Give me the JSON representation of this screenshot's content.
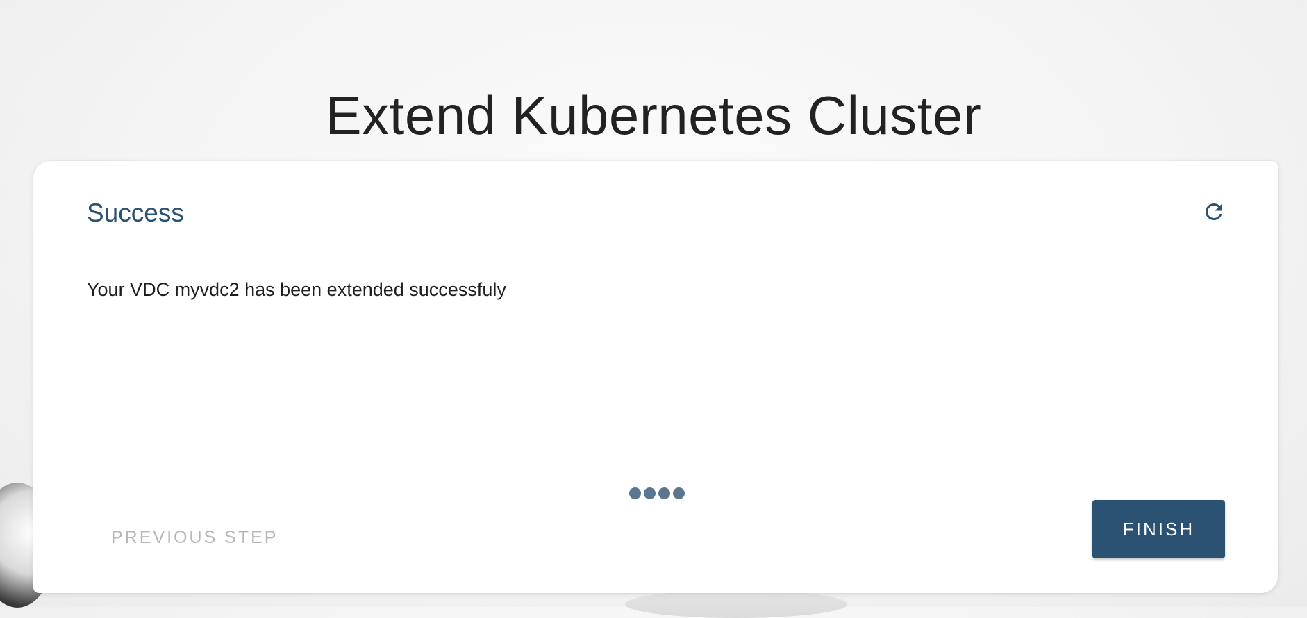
{
  "page": {
    "title": "Extend Kubernetes Cluster"
  },
  "card": {
    "title": "Success",
    "message": "Your VDC myvdc2 has been extended successfuly",
    "refresh_icon": "refresh-icon",
    "steps": {
      "total": 4,
      "current": 4
    },
    "previous_label": "PREVIOUS STEP",
    "finish_label": "FINISH"
  },
  "colors": {
    "primary": "#2c5273",
    "title_accent": "#2b5272",
    "step_dot": "#5a7691",
    "disabled_text": "#b6b6b6"
  }
}
